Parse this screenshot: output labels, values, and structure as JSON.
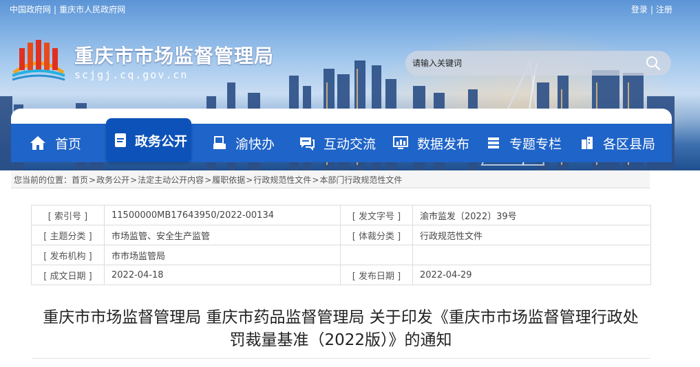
{
  "top_links": {
    "gov_cn": "中国政府网",
    "cq_gov": "重庆市人民政府网",
    "separator": "|"
  },
  "auth": {
    "login": "登录",
    "register": "注册",
    "separator": "|"
  },
  "header": {
    "site_title": "重庆市市场监督管理局",
    "site_domain": "scjgj.cq.gov.cn",
    "logo_icon": "chongqing-emblem-icon"
  },
  "search": {
    "placeholder": "请输入关键词",
    "icon": "search-icon"
  },
  "nav": {
    "items": [
      {
        "label": "首页",
        "icon": "home-icon"
      },
      {
        "label": "政务公开",
        "icon": "document-icon",
        "active": true
      },
      {
        "label": "渝快办",
        "icon": "printer-icon"
      },
      {
        "label": "互动交流",
        "icon": "chat-icon"
      },
      {
        "label": "数据发布",
        "icon": "monitor-chart-icon"
      },
      {
        "label": "专题专栏",
        "icon": "layers-icon"
      },
      {
        "label": "各区县局",
        "icon": "buildings-icon"
      }
    ],
    "color": "#1f64c8",
    "active_color": "#0d52b8"
  },
  "breadcrumb": {
    "prefix": "您当前的位置：",
    "items": [
      "首页",
      "政务公开",
      "法定主动公开内容",
      "履职依据",
      "行政规范性文件",
      "本部门行政规范性文件"
    ],
    "separator": ">"
  },
  "meta": {
    "index_no_label": "[ 索引号 ]",
    "index_no": "11500000MB17643950/2022-00134",
    "doc_no_label": "[ 发文字号 ]",
    "doc_no": "渝市监发〔2022〕39号",
    "topic_label": "[ 主题分类 ]",
    "topic": "市场监管、安全生产监管",
    "genre_label": "[ 体裁分类 ]",
    "genre": "行政规范性文件",
    "issuer_label": "[ 发布机构 ]",
    "issuer": "市市场监管局",
    "created_label": "[ 成文日期 ]",
    "created": "2022-04-18",
    "published_label": "[ 发布日期 ]",
    "published": "2022-04-29"
  },
  "document": {
    "title_line1": "重庆市市场监督管理局 重庆市药品监督管理局 关于印发《重庆市市场监督管理行政处",
    "title_line2": "罚裁量基准（2022版）》的通知"
  }
}
